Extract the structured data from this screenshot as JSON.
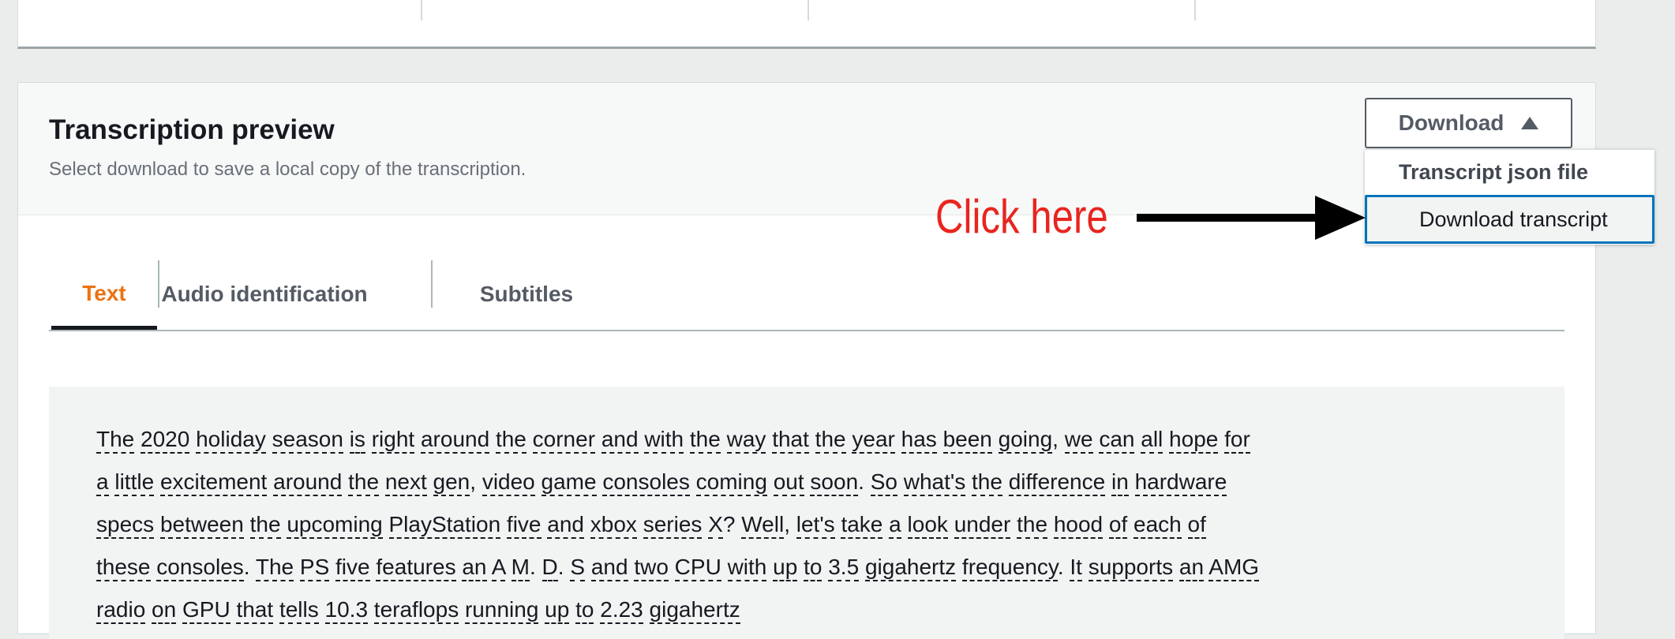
{
  "panel": {
    "title": "Transcription preview",
    "subtitle": "Select download to save a local copy of the transcription."
  },
  "download": {
    "label": "Download",
    "menu": [
      "Transcript json file",
      "Download transcript"
    ]
  },
  "annotation": {
    "text": "Click here",
    "color": "#e8251f"
  },
  "tabs": [
    {
      "label": "Text",
      "active": true
    },
    {
      "label": "Audio identification",
      "active": false
    },
    {
      "label": "Subtitles",
      "active": false
    }
  ],
  "transcript": {
    "text": "The 2020 holiday season is right around the corner and with the way that the year has been going, we can all hope for a little excitement around the next gen, video game consoles coming out soon. So what's the difference in hardware specs between the upcoming PlayStation five and xbox series X? Well, let's take a look under the hood of each of these consoles. The PS five features an A M. D. S and two CPU with up to 3.5 gigahertz frequency. It supports an AMG radio on GPU that tells 10.3 teraflops running up to 2.23 gigahertz"
  },
  "colors": {
    "accent_tab": "#ec7211",
    "focus_border": "#0073bb",
    "annotation": "#e8251f"
  }
}
